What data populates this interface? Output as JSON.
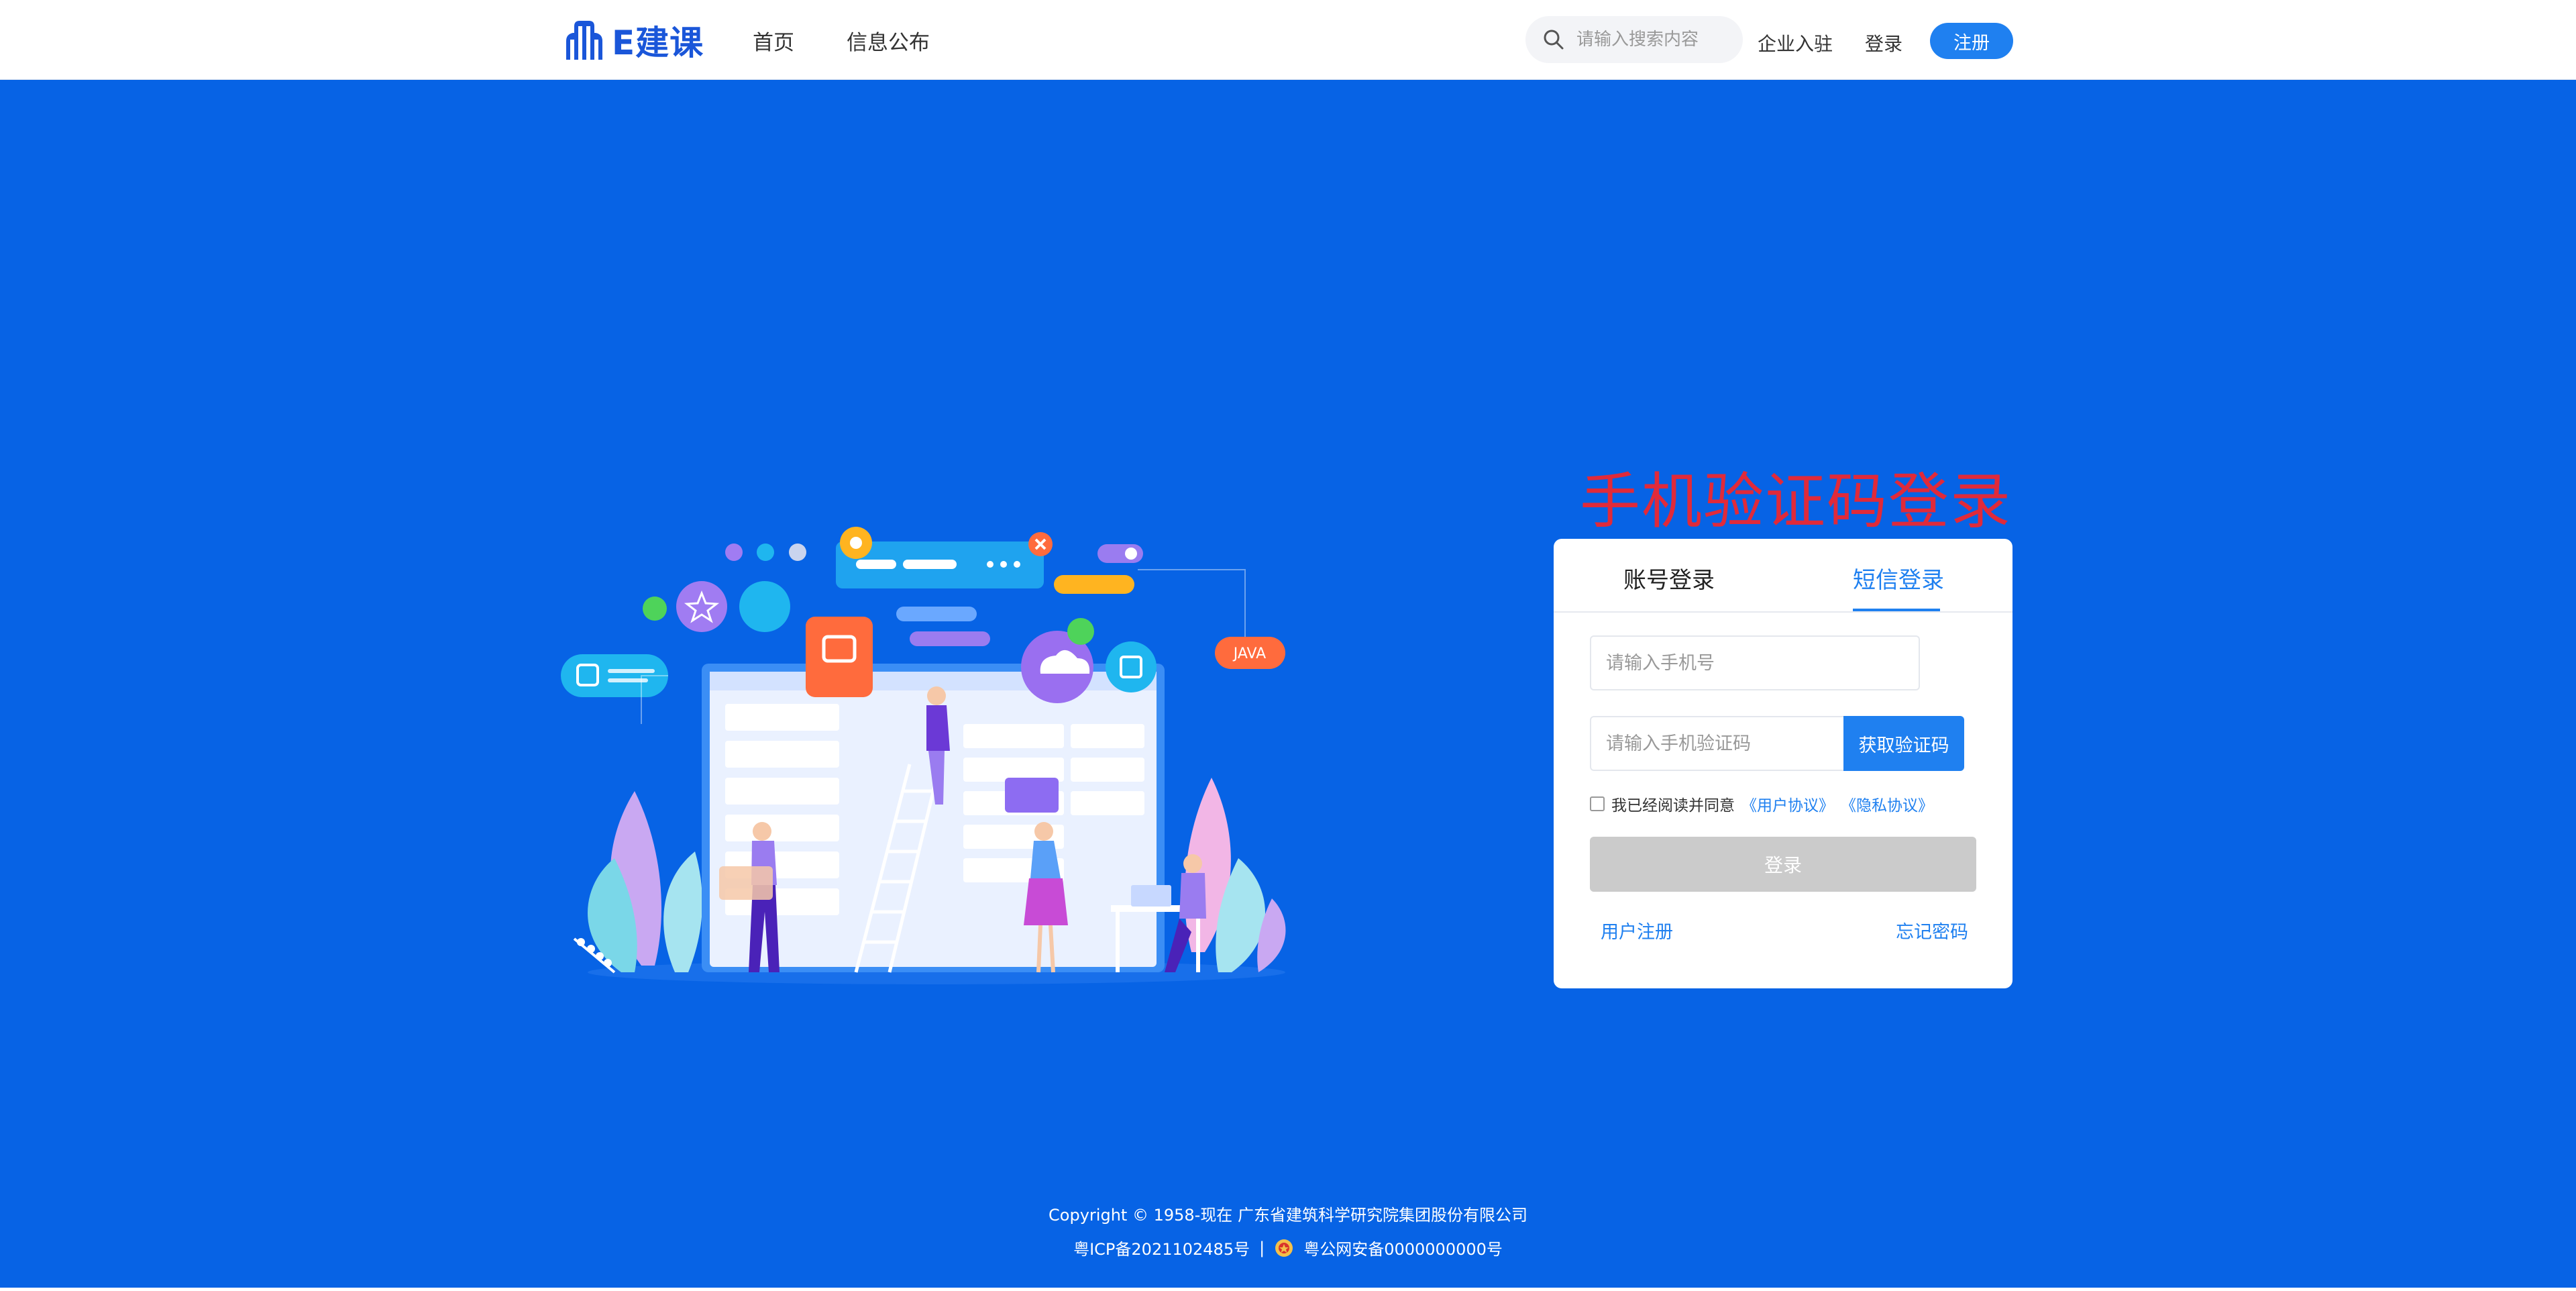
{
  "header": {
    "logo_text": "E建课",
    "nav": [
      "首页",
      "信息公布"
    ],
    "search_placeholder": "请输入搜索内容",
    "enterprise_label": "企业入驻",
    "login_label": "登录",
    "register_label": "注册"
  },
  "main": {
    "title": "手机验证码登录",
    "illustration_badge": "JAVA",
    "tabs": [
      "账号登录",
      "短信登录"
    ],
    "active_tab": "短信登录",
    "phone_placeholder": "请输入手机号",
    "code_placeholder": "请输入手机验证码",
    "get_code_label": "获取验证码",
    "agree_text": "我已经阅读并同意",
    "user_agreement": "《用户协议》",
    "privacy_agreement": "《隐私协议》",
    "login_button": "登录",
    "user_register": "用户注册",
    "forgot_password": "忘记密码"
  },
  "footer": {
    "copyright": "Copyright © 1958-现在 广东省建筑科学研究院集团股份有限公司",
    "icp": "粤ICP备2021102485号",
    "separator": "|",
    "police": "粤公网安备0000000000号"
  },
  "colors": {
    "primary_blue": "#1f80f0",
    "background_blue": "#0763e5",
    "title_red": "#e02a3a",
    "disabled_gray": "#cbcbcb"
  }
}
